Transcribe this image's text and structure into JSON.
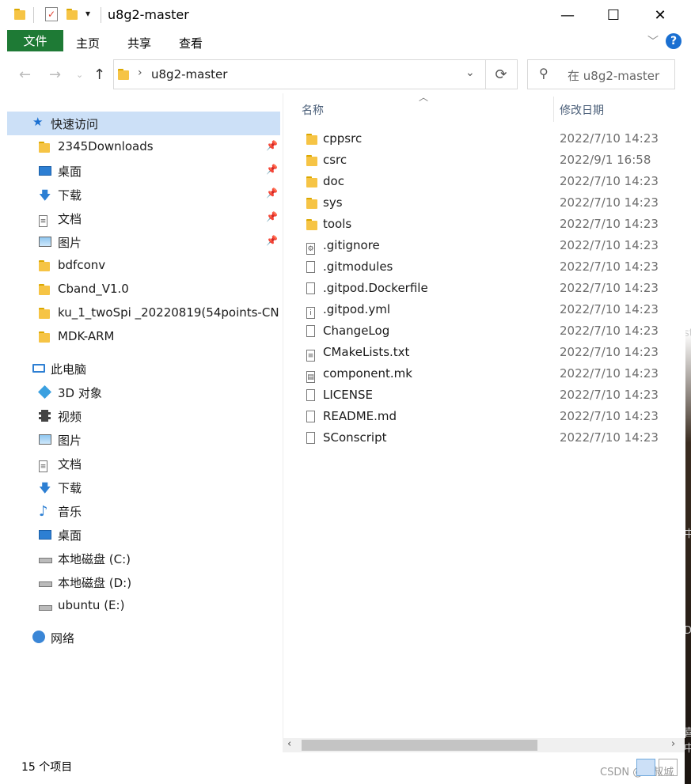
{
  "window": {
    "title": "u8g2-master",
    "qa_dropdown": "▾"
  },
  "ribbon": {
    "file_tab": "文件",
    "tabs": [
      "主页",
      "共享",
      "查看"
    ],
    "help": "?"
  },
  "address": {
    "path": "u8g2-master",
    "search_placeholder": "在 u8g2-master ..."
  },
  "nav": {
    "quick_access": "快速访问",
    "quick_items": [
      {
        "label": "2345Downloads",
        "icon": "folder-icon",
        "pinned": true
      },
      {
        "label": "桌面",
        "icon": "desktop-icon",
        "pinned": true
      },
      {
        "label": "下载",
        "icon": "download-icon",
        "pinned": true
      },
      {
        "label": "文档",
        "icon": "documents-icon",
        "pinned": true
      },
      {
        "label": "图片",
        "icon": "pictures-icon",
        "pinned": true
      },
      {
        "label": "bdfconv",
        "icon": "folder-icon",
        "pinned": false
      },
      {
        "label": "Cband_V1.0",
        "icon": "folder-icon",
        "pinned": false
      },
      {
        "label": "ku_1_twoSpi _20220819(54points-CNL",
        "icon": "folder-icon",
        "pinned": false
      },
      {
        "label": "MDK-ARM",
        "icon": "folder-icon",
        "pinned": false
      }
    ],
    "this_pc": "此电脑",
    "pc_items": [
      {
        "label": "3D 对象",
        "icon": "3d-objects-icon"
      },
      {
        "label": "视频",
        "icon": "videos-icon"
      },
      {
        "label": "图片",
        "icon": "pictures-icon"
      },
      {
        "label": "文档",
        "icon": "documents-icon"
      },
      {
        "label": "下载",
        "icon": "download-icon"
      },
      {
        "label": "音乐",
        "icon": "music-icon"
      },
      {
        "label": "桌面",
        "icon": "desktop-icon"
      },
      {
        "label": "本地磁盘 (C:)",
        "icon": "system-drive-icon"
      },
      {
        "label": "本地磁盘 (D:)",
        "icon": "drive-icon"
      },
      {
        "label": "ubuntu (E:)",
        "icon": "drive-icon"
      }
    ],
    "network": "网络"
  },
  "list": {
    "col_name": "名称",
    "col_date": "修改日期",
    "files": [
      {
        "name": "cppsrc",
        "date": "2022/7/10 14:23",
        "icon": "folder-icon"
      },
      {
        "name": "csrc",
        "date": "2022/9/1 16:58",
        "icon": "folder-icon"
      },
      {
        "name": "doc",
        "date": "2022/7/10 14:23",
        "icon": "folder-icon"
      },
      {
        "name": "sys",
        "date": "2022/7/10 14:23",
        "icon": "folder-icon"
      },
      {
        "name": "tools",
        "date": "2022/7/10 14:23",
        "icon": "folder-icon"
      },
      {
        "name": ".gitignore",
        "date": "2022/7/10 14:23",
        "icon": "settings-file-icon"
      },
      {
        "name": ".gitmodules",
        "date": "2022/7/10 14:23",
        "icon": "file-icon"
      },
      {
        "name": ".gitpod.Dockerfile",
        "date": "2022/7/10 14:23",
        "icon": "file-icon"
      },
      {
        "name": ".gitpod.yml",
        "date": "2022/7/10 14:23",
        "icon": "info-file-icon"
      },
      {
        "name": "ChangeLog",
        "date": "2022/7/10 14:23",
        "icon": "file-icon"
      },
      {
        "name": "CMakeLists.txt",
        "date": "2022/7/10 14:23",
        "icon": "text-file-icon"
      },
      {
        "name": "component.mk",
        "date": "2022/7/10 14:23",
        "icon": "makefile-icon"
      },
      {
        "name": "LICENSE",
        "date": "2022/7/10 14:23",
        "icon": "file-icon"
      },
      {
        "name": "README.md",
        "date": "2022/7/10 14:23",
        "icon": "file-icon"
      },
      {
        "name": "SConscript",
        "date": "2022/7/10 14:23",
        "icon": "file-icon"
      }
    ]
  },
  "status": {
    "count": "15 个项目",
    "watermark": "CSDN @五叔城"
  },
  "desktop_edge": [
    "st",
    "中",
    "D",
    "喜",
    "中"
  ],
  "colors": {
    "file_tab": "#1e7a35",
    "selected": "#cce0f7",
    "folder": "#f6c445",
    "help": "#1a6fd1"
  }
}
